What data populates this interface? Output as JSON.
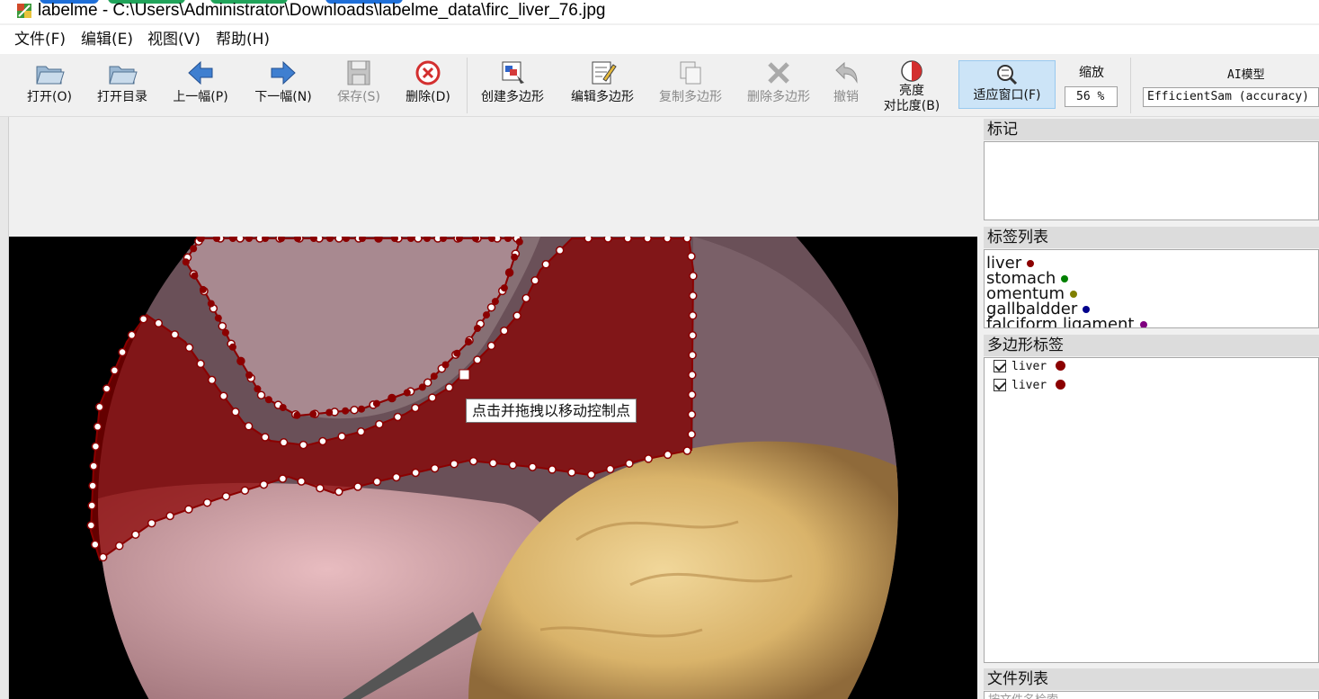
{
  "window": {
    "title": "labelme - C:\\Users\\Administrator\\Downloads\\labelme_data\\firc_liver_76.jpg"
  },
  "menu": [
    {
      "label": "文件(F)"
    },
    {
      "label": "编辑(E)"
    },
    {
      "label": "视图(V)"
    },
    {
      "label": "帮助(H)"
    }
  ],
  "toolbar": {
    "open": "打开(O)",
    "open_dir": "打开目录",
    "prev": "上一幅(P)",
    "next": "下一幅(N)",
    "save": "保存(S)",
    "delete": "删除(D)",
    "create_polygon": "创建多边形",
    "edit_polygon": "编辑多边形",
    "copy_polygon": "复制多边形",
    "delete_polygon": "删除多边形",
    "undo": "撤销",
    "brightness_line1": "亮度",
    "brightness_line2": "对比度(B)",
    "fit_window": "适应窗口(F)",
    "zoom_label": "缩放",
    "zoom_value": "56 %",
    "ai_label": "AI模型",
    "ai_model": "EfficientSam (accuracy)"
  },
  "canvas": {
    "tooltip": "点击并拖拽以移动控制点"
  },
  "dock": {
    "flags_title": "标记",
    "labels_title": "标签列表",
    "labels": [
      {
        "name": "liver",
        "color": "#8b0000"
      },
      {
        "name": "stomach",
        "color": "#008000"
      },
      {
        "name": "omentum",
        "color": "#808000"
      },
      {
        "name": "gallbaldder",
        "color": "#00008b"
      },
      {
        "name": "falciform ligament",
        "color": "#800080"
      }
    ],
    "polygons_title": "多边形标签",
    "polygons": [
      {
        "name": "liver",
        "color": "#8b0000",
        "checked": true
      },
      {
        "name": "liver",
        "color": "#8b0000",
        "checked": true
      }
    ],
    "files_title": "文件列表",
    "files_search_placeholder": "按文件名检索"
  },
  "colors": {
    "polygon_fill": "#8b0000",
    "accent": "#cce4f7"
  }
}
